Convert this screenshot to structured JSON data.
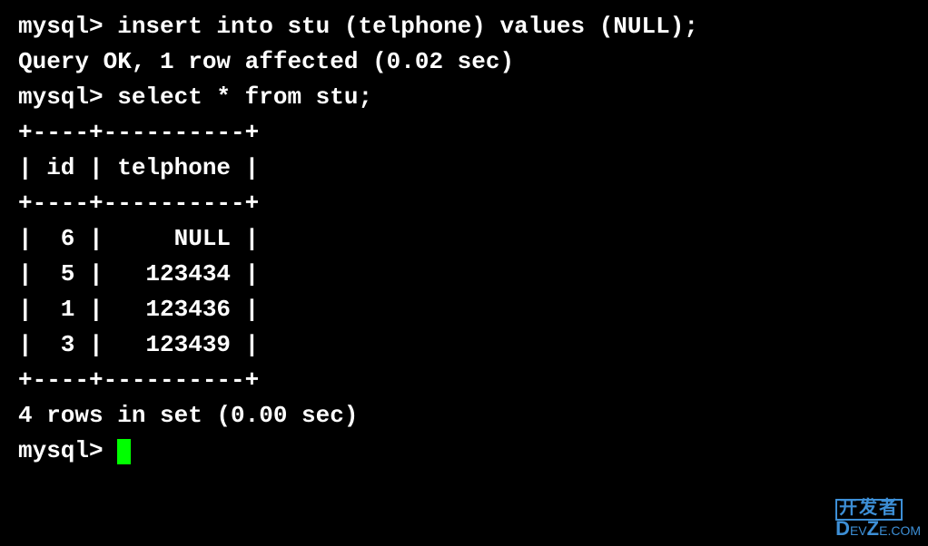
{
  "terminal": {
    "prompt": "mysql>",
    "lines": {
      "l1": "mysql> insert into stu (telphone) values (NULL);",
      "l2": "Query OK, 1 row affected (0.02 sec)",
      "l3": "",
      "l4": "mysql> select * from stu;",
      "l5": "+----+----------+",
      "l6": "| id | telphone |",
      "l7": "+----+----------+",
      "l8": "|  6 |     NULL |",
      "l9": "|  5 |   123434 |",
      "l10": "|  1 |   123436 |",
      "l11": "|  3 |   123439 |",
      "l12": "+----+----------+",
      "l13": "4 rows in set (0.00 sec)",
      "l14": "",
      "l15": "mysql> "
    }
  },
  "chart_data": {
    "type": "table",
    "title": "stu",
    "columns": [
      "id",
      "telphone"
    ],
    "rows": [
      {
        "id": 6,
        "telphone": null
      },
      {
        "id": 5,
        "telphone": 123434
      },
      {
        "id": 1,
        "telphone": 123436
      },
      {
        "id": 3,
        "telphone": 123439
      }
    ],
    "row_count": 4,
    "query_time_sec": 0.0,
    "insert_affected_rows": 1,
    "insert_time_sec": 0.02
  },
  "watermark": {
    "cn": "开发者",
    "en_main": "D",
    "en_rest": "EV",
    "en_z": "Z",
    "en_com": "E.COM"
  }
}
